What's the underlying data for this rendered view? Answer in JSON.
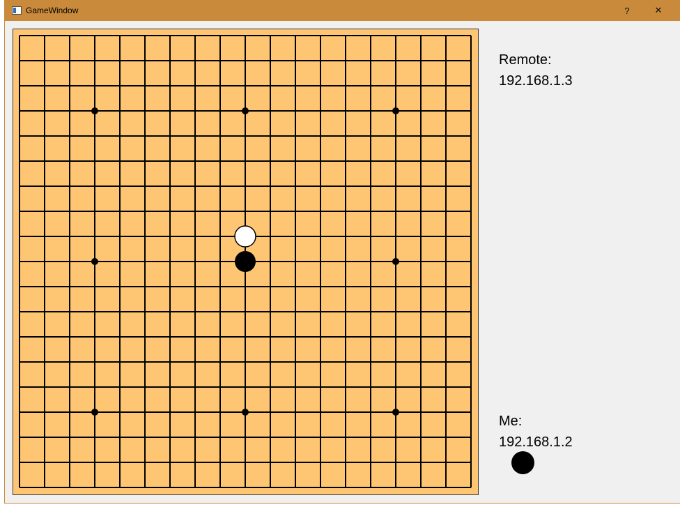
{
  "window": {
    "title": "GameWindow",
    "help_label": "?",
    "close_label": "✕"
  },
  "board": {
    "size": 19,
    "line_color": "#000000",
    "board_color": "#fec673",
    "star_points": [
      [
        3,
        3
      ],
      [
        9,
        3
      ],
      [
        15,
        3
      ],
      [
        3,
        9
      ],
      [
        15,
        9
      ],
      [
        3,
        15
      ],
      [
        9,
        15
      ],
      [
        15,
        15
      ]
    ],
    "stones": [
      {
        "color": "white",
        "col": 9,
        "row": 8
      },
      {
        "color": "black",
        "col": 9,
        "row": 9
      }
    ]
  },
  "remote": {
    "label": "Remote:",
    "ip": "192.168.1.3"
  },
  "me": {
    "label": "Me:",
    "ip": "192.168.1.2",
    "stone_color": "black"
  }
}
